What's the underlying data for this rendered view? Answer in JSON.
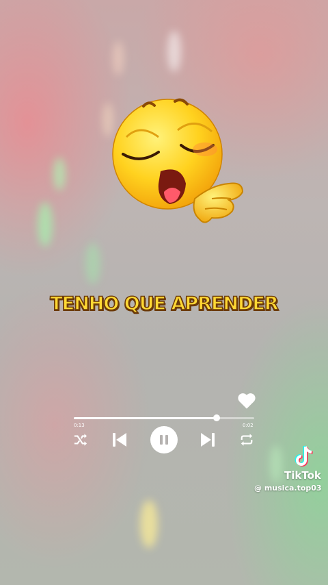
{
  "lyric": {
    "text": "TENHO QUE APRENDER",
    "color": "#ffd934"
  },
  "player": {
    "elapsed": "0:13",
    "total": "0:02",
    "progress": 0.79,
    "liked": true,
    "controls": [
      "shuffle-icon",
      "previous-icon",
      "pause-icon",
      "next-icon",
      "repeat-icon",
      "heart-icon"
    ]
  },
  "watermark": {
    "brand": "TikTok",
    "handle": "@ musica.top03"
  },
  "sticker": {
    "icon": "blowing-kiss-emoji-icon"
  }
}
